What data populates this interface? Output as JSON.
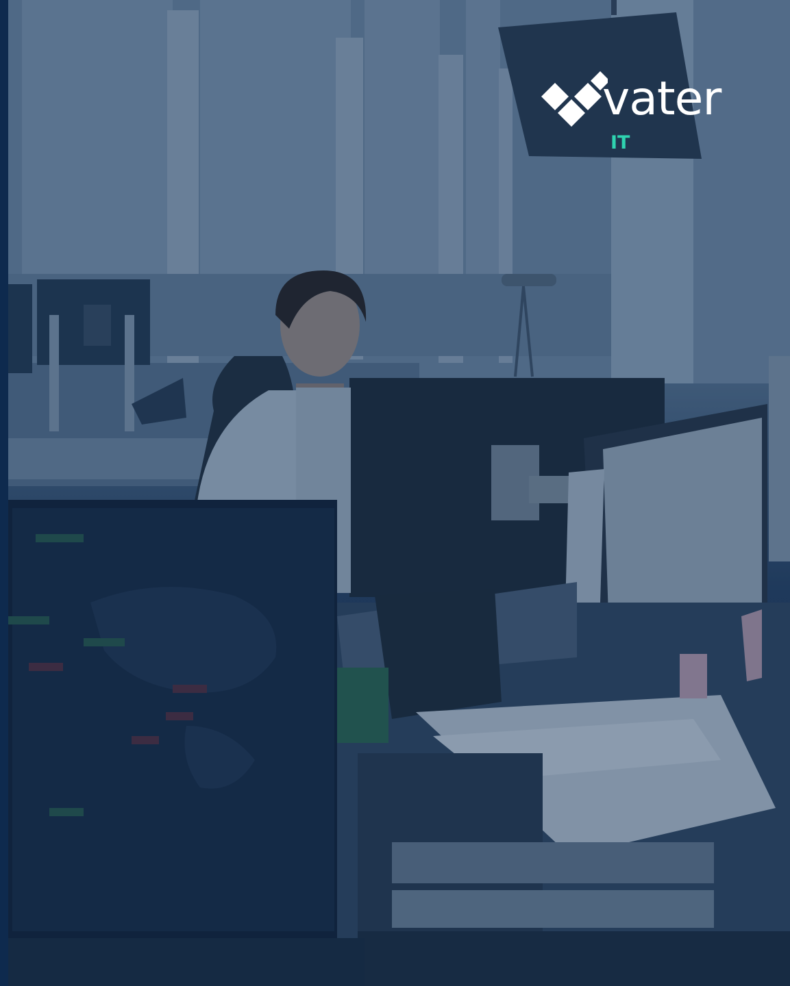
{
  "brand": {
    "name": "vater",
    "sub": "IT",
    "accent_color": "#2fd3b0",
    "text_color": "#ffffff",
    "mark_icon": "diamond-tiles-logo-icon"
  },
  "photo": {
    "overlay_color": "#0e2a4e"
  }
}
